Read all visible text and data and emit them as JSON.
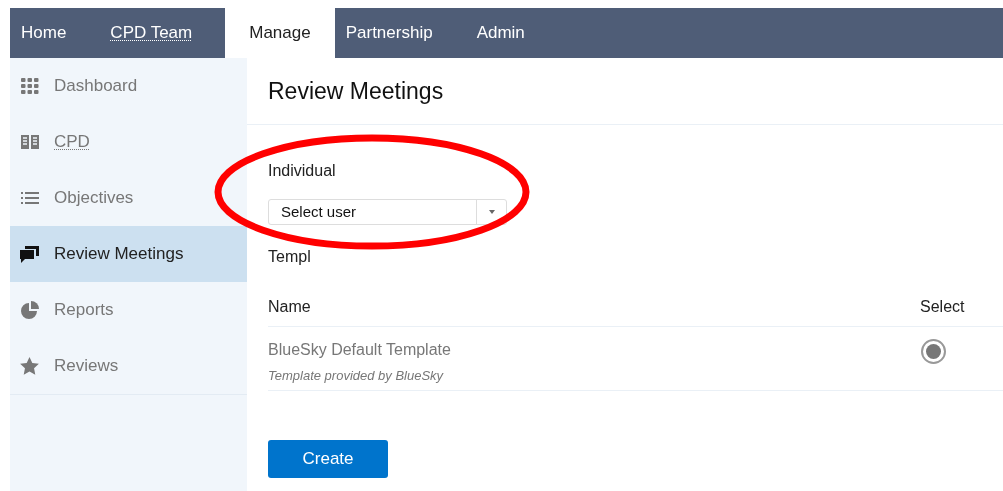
{
  "nav_tabs": [
    {
      "label": "Home",
      "selected": false,
      "abbr": false
    },
    {
      "label": "CPD Team",
      "selected": false,
      "abbr": true
    },
    {
      "label": "Manage",
      "selected": true,
      "abbr": false
    },
    {
      "label": "Partnership",
      "selected": false,
      "abbr": false
    },
    {
      "label": "Admin",
      "selected": false,
      "abbr": false
    }
  ],
  "sidebar": {
    "items": [
      {
        "label": "Dashboard",
        "selected": false,
        "abbr": false
      },
      {
        "label": "CPD",
        "selected": false,
        "abbr": true
      },
      {
        "label": "Objectives",
        "selected": false,
        "abbr": false
      },
      {
        "label": "Review Meetings",
        "selected": true,
        "abbr": false
      },
      {
        "label": "Reports",
        "selected": false,
        "abbr": false
      },
      {
        "label": "Reviews",
        "selected": false,
        "abbr": false
      }
    ]
  },
  "page_title": "Review Meetings",
  "individual": {
    "label": "Individual",
    "select": {
      "value": "Select user"
    }
  },
  "template": {
    "label": "Templ",
    "columns": [
      "Name",
      "Select"
    ],
    "rows": [
      {
        "name": "BlueSky Default Template",
        "description": "Template provided by BlueSky",
        "selected": true
      }
    ]
  },
  "create_button": "Create",
  "annotations": [
    {
      "kind": "ellipse"
    }
  ]
}
